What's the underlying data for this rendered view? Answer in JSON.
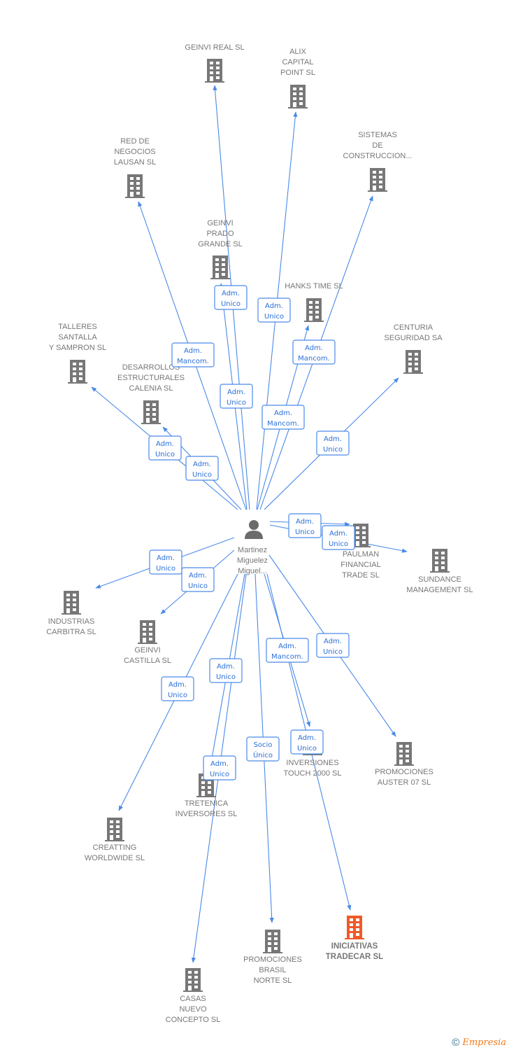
{
  "center": {
    "name_lines": [
      "Martinez",
      "Miguelez",
      "Miguel..."
    ],
    "icon": "person-icon"
  },
  "colors": {
    "edge": "#4a8ae8",
    "company": "#777777",
    "highlight": "#f05a28"
  },
  "nodes": [
    {
      "name_lines": [
        "GEINVI REAL SL"
      ],
      "role_lines": [
        "Adm.",
        "Unico"
      ]
    },
    {
      "name_lines": [
        "ALIX",
        "CAPITAL",
        "POINT SL"
      ],
      "role_lines": [
        "Adm.",
        "Unico"
      ]
    },
    {
      "name_lines": [
        "SISTEMAS",
        "DE",
        "CONSTRUCCION..."
      ],
      "role_lines": [
        "Adm.",
        "Mancom."
      ]
    },
    {
      "name_lines": [
        "RED DE",
        "NEGOCIOS",
        "LAUSAN SL"
      ],
      "role_lines": [
        "Adm.",
        "Mancom."
      ]
    },
    {
      "name_lines": [
        "GEINVI",
        "PRADO",
        "GRANDE SL"
      ],
      "role_lines": [
        "Adm.",
        "Unico"
      ]
    },
    {
      "name_lines": [
        "HANKS TIME SL"
      ],
      "role_lines": [
        "Adm.",
        "Mancom."
      ]
    },
    {
      "name_lines": [
        "CENTURIA",
        "SEGURIDAD SA"
      ],
      "role_lines": [
        "Adm.",
        "Unico"
      ]
    },
    {
      "name_lines": [
        "TALLERES",
        "SANTALLA",
        "Y SAMPRON SL"
      ],
      "role_lines": [
        "Adm.",
        "Unico"
      ]
    },
    {
      "name_lines": [
        "DESARROLLOS",
        "ESTRUCTURALES",
        "CALENIA SL"
      ],
      "role_lines": [
        "Adm.",
        "Unico"
      ]
    },
    {
      "name_lines": [
        "PAULMAN",
        "FINANCIAL",
        "TRADE SL"
      ],
      "role_lines": [
        "Adm.",
        "Unico"
      ]
    },
    {
      "name_lines": [
        "SUNDANCE",
        "MANAGEMENT SL"
      ],
      "role_lines": [
        "Adm.",
        "Unico"
      ]
    },
    {
      "name_lines": [
        "INDUSTRIAS",
        "CARBITRA  SL"
      ],
      "role_lines": [
        "Adm.",
        "Unico"
      ]
    },
    {
      "name_lines": [
        "GEINVI",
        "CASTILLA SL"
      ],
      "role_lines": [
        "Adm.",
        "Unico"
      ]
    },
    {
      "name_lines": [
        "CREATTING",
        "WORLDWIDE SL"
      ],
      "role_lines": [
        "Adm.",
        "Unico"
      ]
    },
    {
      "name_lines": [
        "TRETENICA",
        "INVERSORES SL"
      ],
      "role_lines": [
        "Adm.",
        "Unico"
      ]
    },
    {
      "name_lines": [
        "CASAS",
        "NUEVO",
        "CONCEPTO SL"
      ],
      "role_lines": [
        "Adm.",
        "Unico"
      ]
    },
    {
      "name_lines": [
        "PROMOCIONES",
        "BRASIL",
        "NORTE SL"
      ],
      "role_lines": [
        "Socio",
        "Único"
      ]
    },
    {
      "name_lines": [
        "INVERSIONES",
        "TOUCH 2000 SL"
      ],
      "role_lines": [
        "Adm.",
        "Mancom."
      ]
    },
    {
      "name_lines": [
        "INICIATIVAS",
        "TRADECAR  SL"
      ],
      "role_lines": [
        "Adm.",
        "Unico"
      ],
      "highlight": true
    },
    {
      "name_lines": [
        "PROMOCIONES",
        "AUSTER 07 SL"
      ],
      "role_lines": [
        "Adm.",
        "Unico"
      ]
    }
  ],
  "footer": {
    "copyright": "©",
    "brand": "Empresia"
  }
}
